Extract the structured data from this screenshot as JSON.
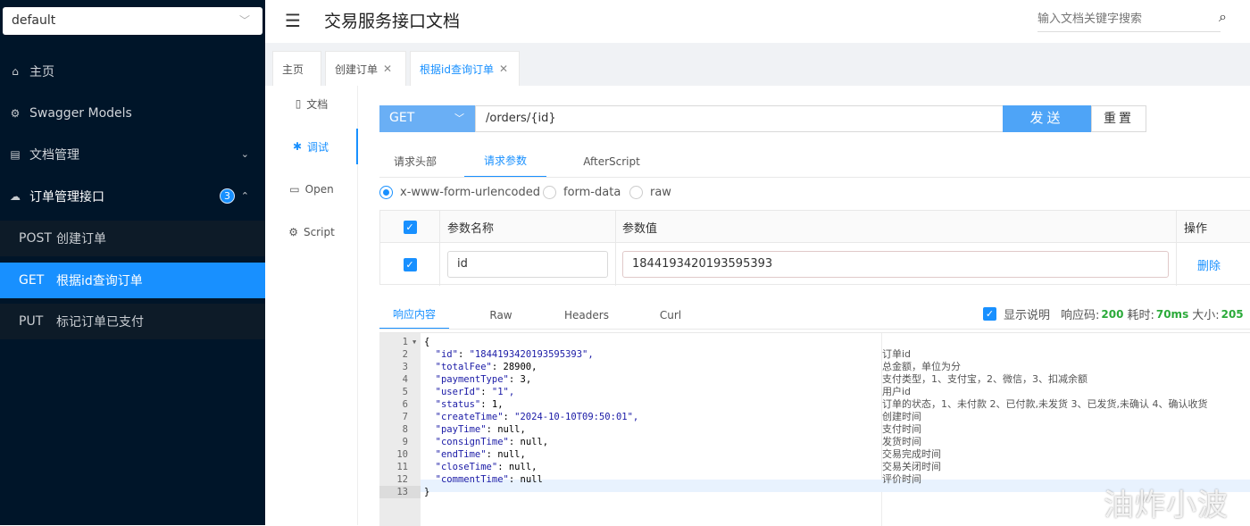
{
  "sidebar": {
    "group_select": "default",
    "nav": [
      {
        "label": "主页",
        "icon": "home-icon"
      },
      {
        "label": "Swagger Models",
        "icon": "models-icon"
      },
      {
        "label": "文档管理",
        "icon": "doc-manage-icon"
      },
      {
        "label": "订单管理接口",
        "icon": "cloud-icon",
        "badge": "3"
      }
    ],
    "apis": [
      {
        "method": "POST",
        "label": "创建订单"
      },
      {
        "method": "GET",
        "label": "根据id查询订单"
      },
      {
        "method": "PUT",
        "label": "标记订单已支付"
      }
    ]
  },
  "header": {
    "title": "交易服务接口文档",
    "search_placeholder": "输入文档关键字搜索"
  },
  "page_tabs": [
    {
      "label": "主页"
    },
    {
      "label": "创建订单"
    },
    {
      "label": "根据id查询订单"
    }
  ],
  "doc_nav": [
    {
      "label": "文档",
      "icon": "document-icon"
    },
    {
      "label": "调试",
      "icon": "bug-icon"
    },
    {
      "label": "Open",
      "icon": "file-icon"
    },
    {
      "label": "Script",
      "icon": "code-icon"
    }
  ],
  "request": {
    "method": "GET",
    "url": "/orders/{id}",
    "send_label": "发送",
    "reset_label": "重置",
    "tabs": [
      "请求头部",
      "请求参数",
      "AfterScript"
    ],
    "body_types": [
      "x-www-form-urlencoded",
      "form-data",
      "raw"
    ]
  },
  "params": {
    "headers": [
      "参数名称",
      "参数值",
      "操作"
    ],
    "rows": [
      {
        "name": "id",
        "value": "1844193420193595393",
        "action": "删除"
      }
    ]
  },
  "response": {
    "tabs": [
      "响应内容",
      "Raw",
      "Headers",
      "Curl"
    ],
    "show_desc_label": "显示说明",
    "code_label": "响应码:",
    "code": "200",
    "time_label": "耗时:",
    "time": "70ms",
    "size_label": "大小:",
    "size": "205",
    "lines": [
      {
        "n": "1",
        "text": "{",
        "comment": ""
      },
      {
        "n": "2",
        "key": "\"id\"",
        "val": " \"1844193420193595393\",",
        "comment": "订单id"
      },
      {
        "n": "3",
        "key": "\"totalFee\"",
        "val": " 28900,",
        "comment": "总金额，单位为分"
      },
      {
        "n": "4",
        "key": "\"paymentType\"",
        "val": " 3,",
        "comment": "支付类型，1、支付宝，2、微信，3、扣减余额"
      },
      {
        "n": "5",
        "key": "\"userId\"",
        "val": " \"1\",",
        "comment": "用户id"
      },
      {
        "n": "6",
        "key": "\"status\"",
        "val": " 1,",
        "comment": "订单的状态，1、未付款 2、已付款,未发货 3、已发货,未确认 4、确认收货"
      },
      {
        "n": "7",
        "key": "\"createTime\"",
        "val": " \"2024-10-10T09:50:01\",",
        "comment": "创建时间"
      },
      {
        "n": "8",
        "key": "\"payTime\"",
        "val": " null,",
        "comment": "支付时间"
      },
      {
        "n": "9",
        "key": "\"consignTime\"",
        "val": " null,",
        "comment": "发货时间"
      },
      {
        "n": "10",
        "key": "\"endTime\"",
        "val": " null,",
        "comment": "交易完成时间"
      },
      {
        "n": "11",
        "key": "\"closeTime\"",
        "val": " null,",
        "comment": "交易关闭时间"
      },
      {
        "n": "12",
        "key": "\"commentTime\"",
        "val": " null",
        "comment": "评价时间"
      },
      {
        "n": "13",
        "text": "}",
        "comment": ""
      }
    ]
  },
  "watermark": "油炸小波"
}
